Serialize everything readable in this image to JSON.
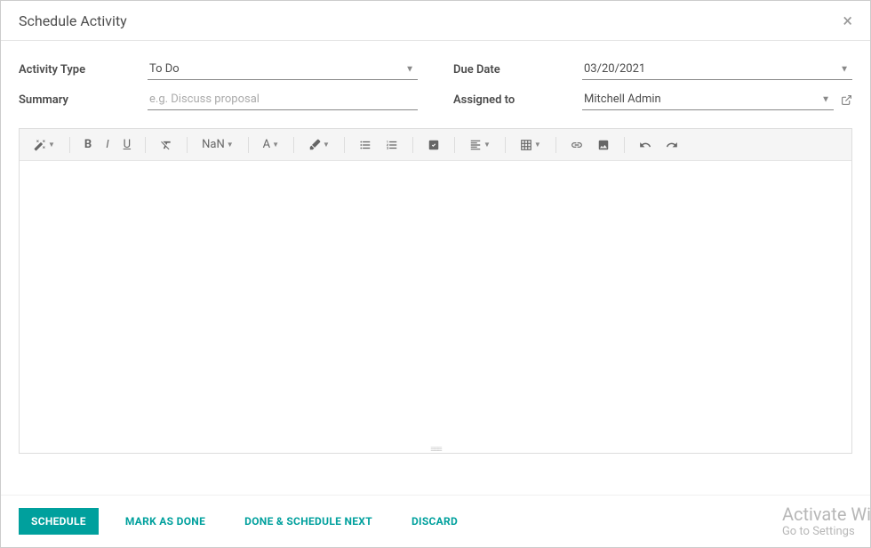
{
  "modal": {
    "title": "Schedule Activity"
  },
  "form": {
    "activity_type_label": "Activity Type",
    "activity_type_value": "To Do",
    "summary_label": "Summary",
    "summary_value": "",
    "summary_placeholder": "e.g. Discuss proposal",
    "due_date_label": "Due Date",
    "due_date_value": "03/20/2021",
    "assigned_to_label": "Assigned to",
    "assigned_to_value": "Mitchell Admin"
  },
  "toolbar": {
    "font_size": "NaN",
    "font_family": "A"
  },
  "footer": {
    "schedule": "SCHEDULE",
    "mark_done": "MARK AS DONE",
    "done_next": "DONE & SCHEDULE NEXT",
    "discard": "DISCARD"
  },
  "watermark": {
    "line1": "Activate Wi",
    "line2": "Go to Settings"
  }
}
